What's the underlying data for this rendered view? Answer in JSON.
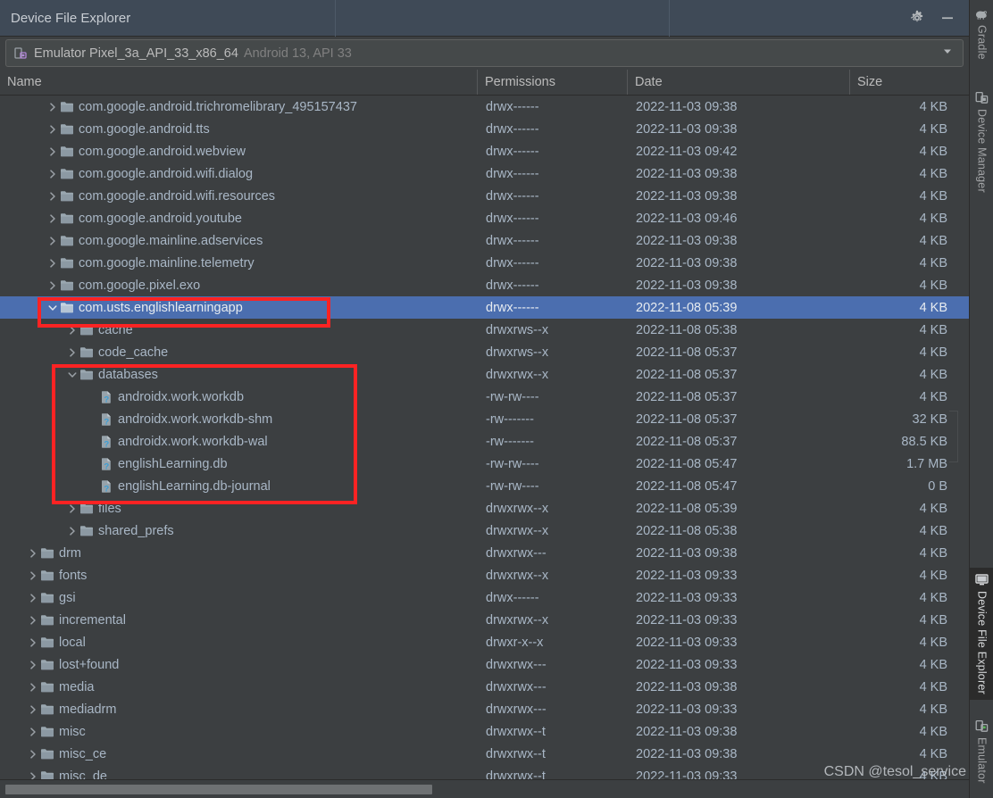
{
  "window": {
    "tab_title": "Device File Explorer",
    "settings_icon": "gear-icon",
    "minimize_icon": "minimize-icon"
  },
  "device": {
    "icon": "device-icon",
    "name": "Emulator Pixel_3a_API_33_x86_64",
    "details": "Android 13, API 33",
    "dropdown_icon": "chevron-down-icon"
  },
  "columns": {
    "name": "Name",
    "permissions": "Permissions",
    "date": "Date",
    "size": "Size"
  },
  "rows": [
    {
      "indent": 2,
      "twisty": "right",
      "icon": "folder-icon",
      "name": "com.google.android.trichromelibrary_495157437",
      "perm": "drwx------",
      "date": "2022-11-03 09:38",
      "size": "4 KB",
      "selected": false
    },
    {
      "indent": 2,
      "twisty": "right",
      "icon": "folder-icon",
      "name": "com.google.android.tts",
      "perm": "drwx------",
      "date": "2022-11-03 09:38",
      "size": "4 KB",
      "selected": false
    },
    {
      "indent": 2,
      "twisty": "right",
      "icon": "folder-icon",
      "name": "com.google.android.webview",
      "perm": "drwx------",
      "date": "2022-11-03 09:42",
      "size": "4 KB",
      "selected": false
    },
    {
      "indent": 2,
      "twisty": "right",
      "icon": "folder-icon",
      "name": "com.google.android.wifi.dialog",
      "perm": "drwx------",
      "date": "2022-11-03 09:38",
      "size": "4 KB",
      "selected": false
    },
    {
      "indent": 2,
      "twisty": "right",
      "icon": "folder-icon",
      "name": "com.google.android.wifi.resources",
      "perm": "drwx------",
      "date": "2022-11-03 09:38",
      "size": "4 KB",
      "selected": false
    },
    {
      "indent": 2,
      "twisty": "right",
      "icon": "folder-icon",
      "name": "com.google.android.youtube",
      "perm": "drwx------",
      "date": "2022-11-03 09:46",
      "size": "4 KB",
      "selected": false
    },
    {
      "indent": 2,
      "twisty": "right",
      "icon": "folder-icon",
      "name": "com.google.mainline.adservices",
      "perm": "drwx------",
      "date": "2022-11-03 09:38",
      "size": "4 KB",
      "selected": false
    },
    {
      "indent": 2,
      "twisty": "right",
      "icon": "folder-icon",
      "name": "com.google.mainline.telemetry",
      "perm": "drwx------",
      "date": "2022-11-03 09:38",
      "size": "4 KB",
      "selected": false
    },
    {
      "indent": 2,
      "twisty": "right",
      "icon": "folder-icon",
      "name": "com.google.pixel.exo",
      "perm": "drwx------",
      "date": "2022-11-03 09:38",
      "size": "4 KB",
      "selected": false
    },
    {
      "indent": 2,
      "twisty": "down",
      "icon": "folder-icon",
      "name": "com.usts.englishlearningapp",
      "perm": "drwx------",
      "date": "2022-11-08 05:39",
      "size": "4 KB",
      "selected": true
    },
    {
      "indent": 3,
      "twisty": "right",
      "icon": "folder-icon",
      "name": "cache",
      "perm": "drwxrws--x",
      "date": "2022-11-08 05:38",
      "size": "4 KB",
      "selected": false
    },
    {
      "indent": 3,
      "twisty": "right",
      "icon": "folder-icon",
      "name": "code_cache",
      "perm": "drwxrws--x",
      "date": "2022-11-08 05:37",
      "size": "4 KB",
      "selected": false
    },
    {
      "indent": 3,
      "twisty": "down",
      "icon": "folder-icon",
      "name": "databases",
      "perm": "drwxrwx--x",
      "date": "2022-11-08 05:37",
      "size": "4 KB",
      "selected": false
    },
    {
      "indent": 4,
      "twisty": "none",
      "icon": "unknown-file-icon",
      "name": "androidx.work.workdb",
      "perm": "-rw-rw----",
      "date": "2022-11-08 05:37",
      "size": "4 KB",
      "selected": false
    },
    {
      "indent": 4,
      "twisty": "none",
      "icon": "unknown-file-icon",
      "name": "androidx.work.workdb-shm",
      "perm": "-rw-------",
      "date": "2022-11-08 05:37",
      "size": "32 KB",
      "selected": false
    },
    {
      "indent": 4,
      "twisty": "none",
      "icon": "unknown-file-icon",
      "name": "androidx.work.workdb-wal",
      "perm": "-rw-------",
      "date": "2022-11-08 05:37",
      "size": "88.5 KB",
      "selected": false
    },
    {
      "indent": 4,
      "twisty": "none",
      "icon": "unknown-file-icon",
      "name": "englishLearning.db",
      "perm": "-rw-rw----",
      "date": "2022-11-08 05:47",
      "size": "1.7 MB",
      "selected": false
    },
    {
      "indent": 4,
      "twisty": "none",
      "icon": "unknown-file-icon",
      "name": "englishLearning.db-journal",
      "perm": "-rw-rw----",
      "date": "2022-11-08 05:47",
      "size": "0 B",
      "selected": false
    },
    {
      "indent": 3,
      "twisty": "right",
      "icon": "folder-icon",
      "name": "files",
      "perm": "drwxrwx--x",
      "date": "2022-11-08 05:39",
      "size": "4 KB",
      "selected": false
    },
    {
      "indent": 3,
      "twisty": "right",
      "icon": "folder-icon",
      "name": "shared_prefs",
      "perm": "drwxrwx--x",
      "date": "2022-11-08 05:38",
      "size": "4 KB",
      "selected": false
    },
    {
      "indent": 1,
      "twisty": "right",
      "icon": "folder-icon",
      "name": "drm",
      "perm": "drwxrwx---",
      "date": "2022-11-03 09:38",
      "size": "4 KB",
      "selected": false
    },
    {
      "indent": 1,
      "twisty": "right",
      "icon": "folder-icon",
      "name": "fonts",
      "perm": "drwxrwx--x",
      "date": "2022-11-03 09:33",
      "size": "4 KB",
      "selected": false
    },
    {
      "indent": 1,
      "twisty": "right",
      "icon": "folder-icon",
      "name": "gsi",
      "perm": "drwx------",
      "date": "2022-11-03 09:33",
      "size": "4 KB",
      "selected": false
    },
    {
      "indent": 1,
      "twisty": "right",
      "icon": "folder-icon",
      "name": "incremental",
      "perm": "drwxrwx--x",
      "date": "2022-11-03 09:33",
      "size": "4 KB",
      "selected": false
    },
    {
      "indent": 1,
      "twisty": "right",
      "icon": "folder-icon",
      "name": "local",
      "perm": "drwxr-x--x",
      "date": "2022-11-03 09:33",
      "size": "4 KB",
      "selected": false
    },
    {
      "indent": 1,
      "twisty": "right",
      "icon": "folder-icon",
      "name": "lost+found",
      "perm": "drwxrwx---",
      "date": "2022-11-03 09:33",
      "size": "4 KB",
      "selected": false
    },
    {
      "indent": 1,
      "twisty": "right",
      "icon": "folder-icon",
      "name": "media",
      "perm": "drwxrwx---",
      "date": "2022-11-03 09:38",
      "size": "4 KB",
      "selected": false
    },
    {
      "indent": 1,
      "twisty": "right",
      "icon": "folder-icon",
      "name": "mediadrm",
      "perm": "drwxrwx---",
      "date": "2022-11-03 09:33",
      "size": "4 KB",
      "selected": false
    },
    {
      "indent": 1,
      "twisty": "right",
      "icon": "folder-icon",
      "name": "misc",
      "perm": "drwxrwx--t",
      "date": "2022-11-03 09:38",
      "size": "4 KB",
      "selected": false
    },
    {
      "indent": 1,
      "twisty": "right",
      "icon": "folder-icon",
      "name": "misc_ce",
      "perm": "drwxrwx--t",
      "date": "2022-11-03 09:38",
      "size": "4 KB",
      "selected": false
    },
    {
      "indent": 1,
      "twisty": "right",
      "icon": "folder-icon",
      "name": "misc_de",
      "perm": "drwxrwx--t",
      "date": "2022-11-03 09:33",
      "size": "4 KB",
      "selected": false
    }
  ],
  "toolstrip": [
    {
      "label": "Gradle",
      "icon": "gradle-elephant-icon",
      "active": false
    },
    {
      "label": "Device Manager",
      "icon": "device-manager-icon",
      "active": false
    },
    {
      "label": "Device File Explorer",
      "icon": "monitor-icon",
      "active": true
    },
    {
      "label": "Emulator",
      "icon": "emulator-icon",
      "active": false
    }
  ],
  "watermark": "CSDN @tesol_service",
  "colors": {
    "selection": "#4b6eaf",
    "annotation": "#fc2323",
    "background": "#3c3f41",
    "titlebar": "#3f4a57",
    "text": "#a9b7c6"
  }
}
